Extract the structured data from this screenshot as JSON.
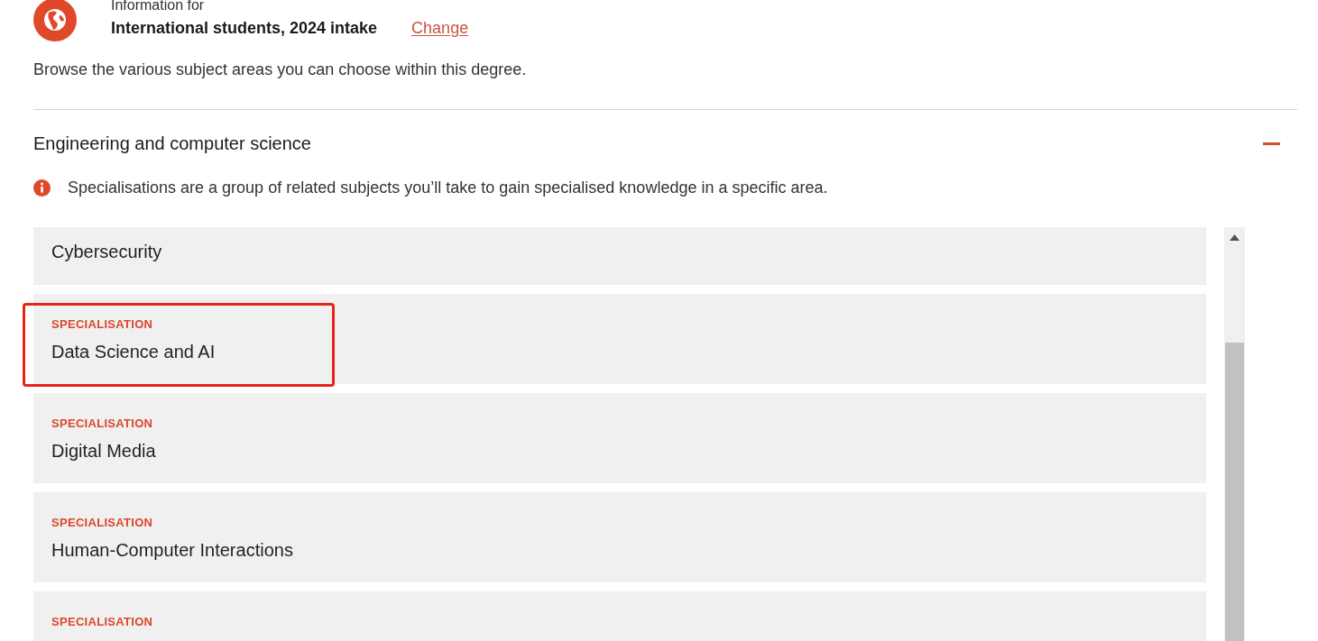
{
  "audience": {
    "caption": "Information for",
    "value": "International students, 2024 intake",
    "change_link": "Change"
  },
  "intro": "Browse the various subject areas you can choose within this degree.",
  "section": {
    "title": "Engineering and computer science",
    "expanded": true,
    "note": "Specialisations are a group of related subjects you’ll take to gain specialised knowledge in a specific area.",
    "items": [
      {
        "name": "Cybersecurity",
        "highlighted": false
      },
      {
        "label": "SPECIALISATION",
        "name": "Data Science and AI",
        "highlighted": true
      },
      {
        "label": "SPECIALISATION",
        "name": "Digital Media",
        "highlighted": false
      },
      {
        "label": "SPECIALISATION",
        "name": "Human-Computer Interactions",
        "highlighted": false
      },
      {
        "label": "SPECIALISATION",
        "highlighted": false
      }
    ]
  }
}
